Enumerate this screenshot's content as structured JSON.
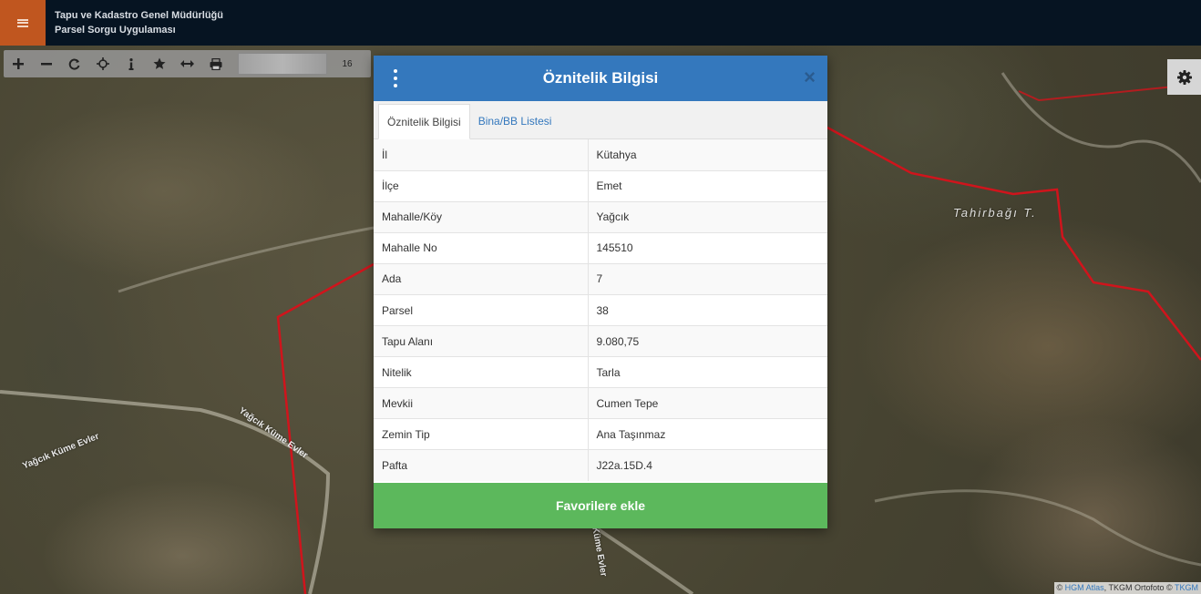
{
  "app": {
    "title_line1": "Tapu ve Kadastro Genel Müdürlüğü",
    "title_line2": "Parsel Sorgu Uygulaması"
  },
  "toolbar": {
    "zoom_level": "16"
  },
  "map": {
    "place_label": "Tahirbağı T.",
    "road_labels": [
      "Yağcık Küme Evler",
      "Yağcık Küme Evler",
      "Küme Evler"
    ],
    "boundary_color": "#d0141c"
  },
  "modal": {
    "title": "Öznitelik Bilgisi",
    "close": "×",
    "tabs": [
      {
        "label": "Öznitelik Bilgisi",
        "active": true
      },
      {
        "label": "Bina/BB Listesi",
        "active": false
      }
    ],
    "rows": [
      {
        "key": "İl",
        "value": "Kütahya"
      },
      {
        "key": "İlçe",
        "value": "Emet"
      },
      {
        "key": "Mahalle/Köy",
        "value": "Yağcık"
      },
      {
        "key": "Mahalle No",
        "value": "145510"
      },
      {
        "key": "Ada",
        "value": "7"
      },
      {
        "key": "Parsel",
        "value": "38"
      },
      {
        "key": "Tapu Alanı",
        "value": "9.080,75"
      },
      {
        "key": "Nitelik",
        "value": "Tarla"
      },
      {
        "key": "Mevkii",
        "value": "Cumen Tepe"
      },
      {
        "key": "Zemin Tip",
        "value": "Ana Taşınmaz"
      },
      {
        "key": "Pafta",
        "value": "J22a.15D.4"
      }
    ],
    "favorite_button": "Favorilere ekle",
    "header_color": "#3478bd",
    "button_color": "#5cb85c"
  },
  "attribution": {
    "prefix": "©",
    "hgm": "HGM Atlas",
    "middle": ", TKGM Ortofoto ©",
    "tkgm": "TKGM"
  }
}
